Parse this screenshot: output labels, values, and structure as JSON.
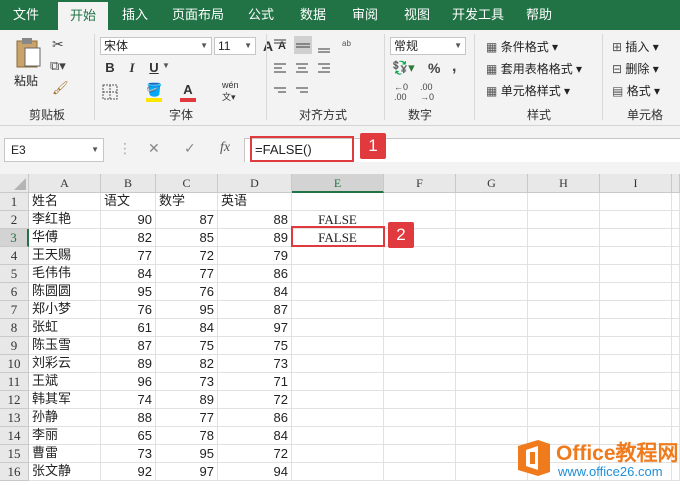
{
  "tabs": [
    "文件",
    "开始",
    "插入",
    "页面布局",
    "公式",
    "数据",
    "审阅",
    "视图",
    "开发工具",
    "帮助"
  ],
  "ribbon": {
    "clipboard": {
      "label": "剪贴板",
      "paste": "粘贴"
    },
    "font": {
      "label": "字体",
      "font_name": "宋体",
      "font_size": "11",
      "bold": "B",
      "italic": "I",
      "underline": "U",
      "grow": "A",
      "shrink": "A",
      "font_color": "A",
      "wen": "wén"
    },
    "alignment": {
      "label": "对齐方式"
    },
    "number": {
      "label": "数字",
      "format": "常规",
      "percent": "%",
      "comma": ","
    },
    "styles": {
      "label": "样式",
      "conditional": "条件格式",
      "table": "套用表格格式",
      "cell_styles": "单元格样式"
    },
    "cells": {
      "label": "单元格",
      "insert": "插入",
      "delete": "删除",
      "format": "格式"
    }
  },
  "formula_bar": {
    "name_box": "E3",
    "formula": "=FALSE()",
    "fx": "fx"
  },
  "callouts": {
    "one": "1",
    "two": "2"
  },
  "columns": [
    "A",
    "B",
    "C",
    "D",
    "E",
    "F",
    "G",
    "H",
    "I"
  ],
  "header_row": [
    "姓名",
    "语文",
    "数学",
    "英语"
  ],
  "rows": [
    {
      "n": "1"
    },
    {
      "n": "2",
      "name": "李红艳",
      "c": "90",
      "m": "87",
      "e": "88",
      "r": "FALSE"
    },
    {
      "n": "3",
      "name": "华傅",
      "c": "82",
      "m": "85",
      "e": "89",
      "r": "FALSE"
    },
    {
      "n": "4",
      "name": "王天赐",
      "c": "77",
      "m": "72",
      "e": "79"
    },
    {
      "n": "5",
      "name": "毛伟伟",
      "c": "84",
      "m": "77",
      "e": "86"
    },
    {
      "n": "6",
      "name": "陈圆圆",
      "c": "95",
      "m": "76",
      "e": "84"
    },
    {
      "n": "7",
      "name": "郑小梦",
      "c": "76",
      "m": "95",
      "e": "87"
    },
    {
      "n": "8",
      "name": "张虹",
      "c": "61",
      "m": "84",
      "e": "97"
    },
    {
      "n": "9",
      "name": "陈玉雪",
      "c": "87",
      "m": "75",
      "e": "75"
    },
    {
      "n": "10",
      "name": "刘彩云",
      "c": "89",
      "m": "82",
      "e": "73"
    },
    {
      "n": "11",
      "name": "王斌",
      "c": "96",
      "m": "73",
      "e": "71"
    },
    {
      "n": "12",
      "name": "韩其军",
      "c": "74",
      "m": "89",
      "e": "72"
    },
    {
      "n": "13",
      "name": "孙静",
      "c": "88",
      "m": "77",
      "e": "86"
    },
    {
      "n": "14",
      "name": "李丽",
      "c": "65",
      "m": "78",
      "e": "84"
    },
    {
      "n": "15",
      "name": "曹雷",
      "c": "73",
      "m": "95",
      "e": "72"
    },
    {
      "n": "16",
      "name": "张文静",
      "c": "92",
      "m": "97",
      "e": "94"
    }
  ],
  "watermark": {
    "brand": "Office教程网",
    "url": "www.office26.com"
  },
  "colors": {
    "excel_green": "#217346",
    "highlight_red": "#e0393e",
    "watermark_orange": "#f07b1d",
    "watermark_blue": "#1f8fd8"
  }
}
